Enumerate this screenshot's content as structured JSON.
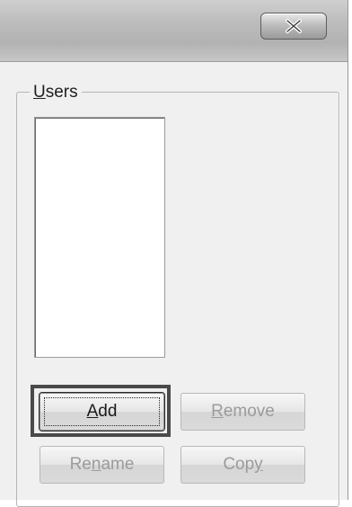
{
  "window": {
    "close_symbol": "X"
  },
  "users_group": {
    "label_first": "U",
    "label_rest": "sers"
  },
  "buttons": {
    "add": {
      "pre": "",
      "mnemonic": "A",
      "post": "dd"
    },
    "remove": {
      "pre": "",
      "mnemonic": "R",
      "post": "emove"
    },
    "rename": {
      "pre": "Re",
      "mnemonic": "n",
      "post": "ame"
    },
    "copy": {
      "pre": "Cop",
      "mnemonic": "y",
      "post": ""
    }
  },
  "icons": {
    "close": "close-icon"
  },
  "colors": {
    "highlight_border": "#4a4a4a",
    "disabled_text": "#9b9b9b"
  }
}
